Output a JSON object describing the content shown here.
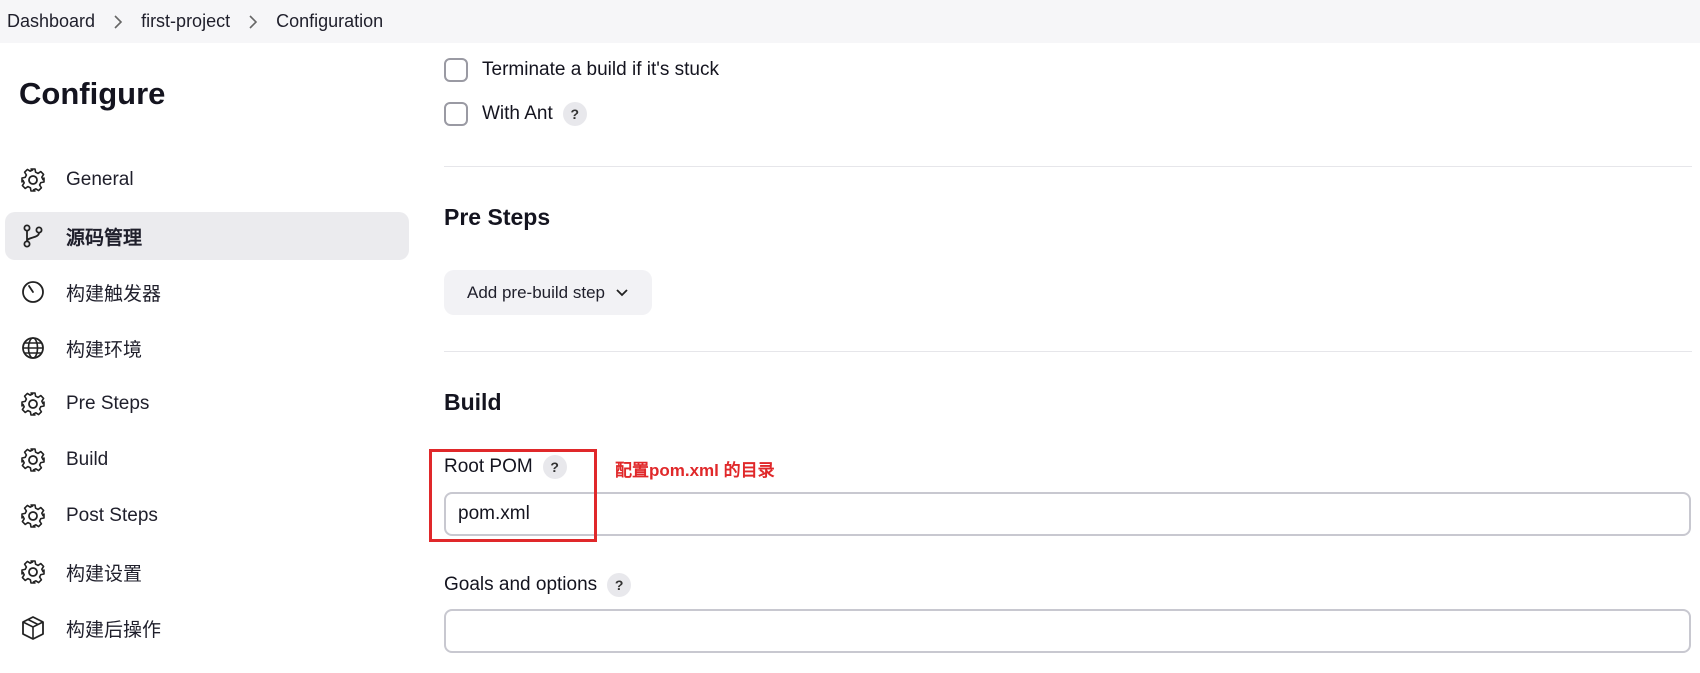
{
  "breadcrumb": [
    "Dashboard",
    "first-project",
    "Configuration"
  ],
  "page_title": "Configure",
  "sidebar": {
    "items": [
      {
        "label": "General",
        "icon": "gear-icon",
        "active": false
      },
      {
        "label": "源码管理",
        "icon": "git-branch-icon",
        "active": true
      },
      {
        "label": "构建触发器",
        "icon": "timer-icon",
        "active": false
      },
      {
        "label": "构建环境",
        "icon": "globe-icon",
        "active": false
      },
      {
        "label": "Pre Steps",
        "icon": "gear-icon",
        "active": false
      },
      {
        "label": "Build",
        "icon": "gear-icon",
        "active": false
      },
      {
        "label": "Post Steps",
        "icon": "gear-icon",
        "active": false
      },
      {
        "label": "构建设置",
        "icon": "gear-icon",
        "active": false
      },
      {
        "label": "构建后操作",
        "icon": "package-icon",
        "active": false
      }
    ]
  },
  "options": {
    "terminate_stuck_label": "Terminate a build if it's stuck",
    "with_ant_label": "With Ant"
  },
  "pre_steps": {
    "title": "Pre Steps",
    "add_button": "Add pre-build step"
  },
  "build": {
    "title": "Build",
    "root_pom_label": "Root POM",
    "root_pom_value": "pom.xml",
    "goals_label": "Goals and options",
    "goals_value": ""
  },
  "help_glyph": "?",
  "annotation": {
    "text": "配置pom.xml 的目录",
    "color": "#e0282a"
  }
}
